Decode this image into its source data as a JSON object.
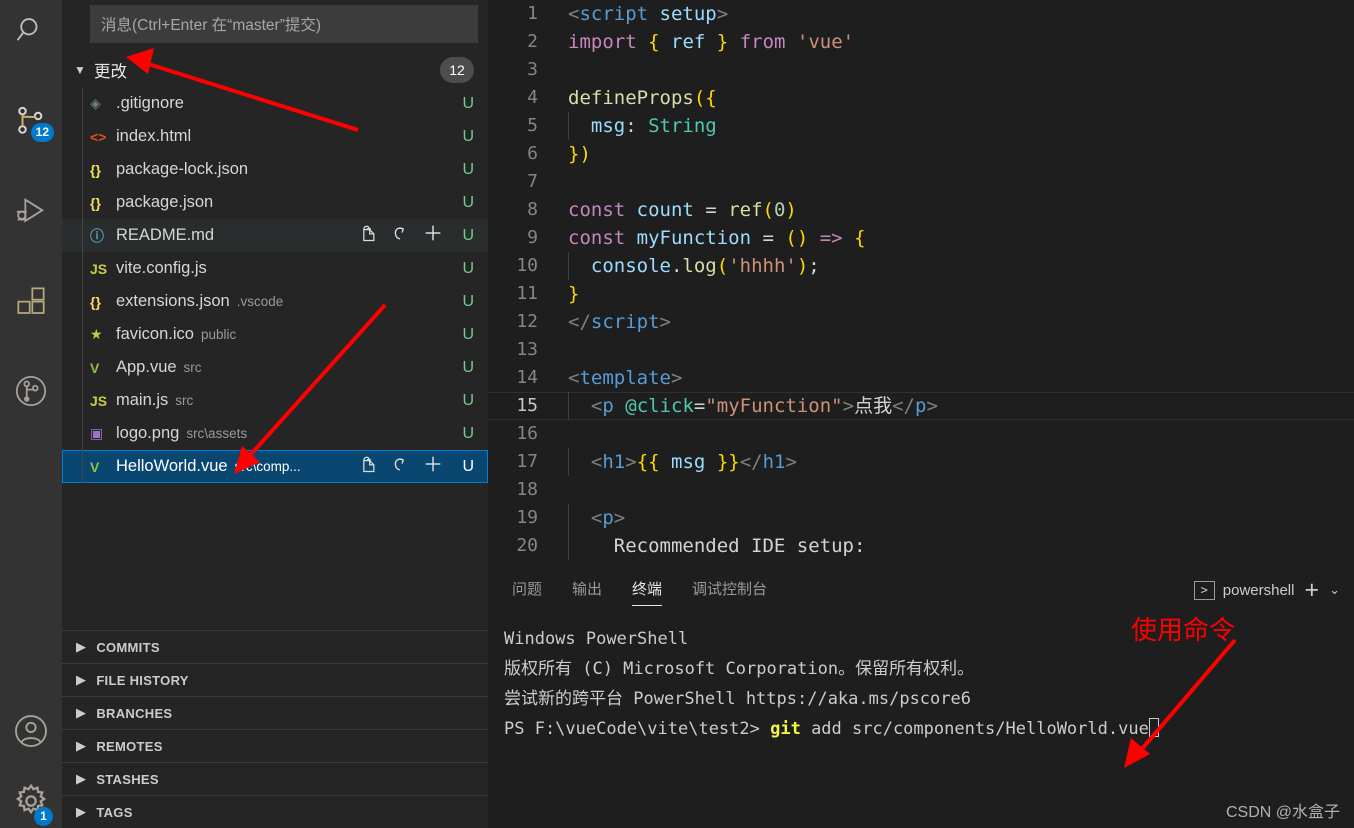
{
  "activitybar": {
    "items": [
      {
        "name": "search-icon",
        "badge": null
      },
      {
        "name": "source-control-icon",
        "badge": "12"
      },
      {
        "name": "run-debug-icon",
        "badge": null
      },
      {
        "name": "extensions-icon",
        "badge": null
      },
      {
        "name": "git-graph-icon",
        "badge": null
      }
    ],
    "bottom": [
      {
        "name": "accounts-icon",
        "badge": null
      },
      {
        "name": "settings-gear-icon",
        "badge": "1"
      }
    ]
  },
  "sidebar": {
    "commit_input_placeholder": "消息(Ctrl+Enter 在“master”提交)",
    "changes_label": "更改",
    "changes_count": "12",
    "row_actions": {
      "open_file": "open-file-icon",
      "discard": "discard-changes-icon",
      "stage": "stage-changes-icon"
    },
    "files": [
      {
        "icon": "git-file-icon",
        "icon_glyph": "◈",
        "icon_color": "#6d8086",
        "name": ".gitignore",
        "path": "",
        "status": "U",
        "state": "normal"
      },
      {
        "icon": "html-file-icon",
        "icon_glyph": "<>",
        "icon_color": "#e44d26",
        "name": "index.html",
        "path": "",
        "status": "U",
        "state": "normal"
      },
      {
        "icon": "json-file-icon",
        "icon_glyph": "{}",
        "icon_color": "#f1e05a",
        "name": "package-lock.json",
        "path": "",
        "status": "U",
        "state": "normal"
      },
      {
        "icon": "json-file-icon",
        "icon_glyph": "{}",
        "icon_color": "#f1e05a",
        "name": "package.json",
        "path": "",
        "status": "U",
        "state": "normal"
      },
      {
        "icon": "markdown-file-icon",
        "icon_glyph": "ⓘ",
        "icon_color": "#519aba",
        "name": "README.md",
        "path": "",
        "status": "U",
        "state": "hovered"
      },
      {
        "icon": "js-file-icon",
        "icon_glyph": "JS",
        "icon_color": "#cbcb41",
        "name": "vite.config.js",
        "path": "",
        "status": "U",
        "state": "normal"
      },
      {
        "icon": "json-file-icon",
        "icon_glyph": "{}",
        "icon_color": "#f1e05a",
        "name": "extensions.json",
        "path": ".vscode",
        "status": "U",
        "state": "normal"
      },
      {
        "icon": "favicon-file-icon",
        "icon_glyph": "★",
        "icon_color": "#cbcb41",
        "name": "favicon.ico",
        "path": "public",
        "status": "U",
        "state": "normal"
      },
      {
        "icon": "vue-file-icon",
        "icon_glyph": "V",
        "icon_color": "#8dc149",
        "name": "App.vue",
        "path": "src",
        "status": "U",
        "state": "normal"
      },
      {
        "icon": "js-file-icon",
        "icon_glyph": "JS",
        "icon_color": "#cbcb41",
        "name": "main.js",
        "path": "src",
        "status": "U",
        "state": "normal"
      },
      {
        "icon": "image-file-icon",
        "icon_glyph": "▣",
        "icon_color": "#a074c4",
        "name": "logo.png",
        "path": "src\\assets",
        "status": "U",
        "state": "normal"
      },
      {
        "icon": "vue-file-icon",
        "icon_glyph": "V",
        "icon_color": "#8dc149",
        "name": "HelloWorld.vue",
        "path": "src\\comp...",
        "status": "U",
        "state": "selected"
      }
    ],
    "sections": [
      {
        "label": "COMMITS"
      },
      {
        "label": "FILE HISTORY"
      },
      {
        "label": "BRANCHES"
      },
      {
        "label": "REMOTES"
      },
      {
        "label": "STASHES"
      },
      {
        "label": "TAGS"
      }
    ]
  },
  "editor": {
    "active_line": 15,
    "lines": [
      {
        "n": "1",
        "indent": false,
        "tokens": [
          {
            "c": "t-punc",
            "t": "<"
          },
          {
            "c": "t-tag",
            "t": "script"
          },
          {
            "c": "t-white",
            "t": " "
          },
          {
            "c": "t-attr",
            "t": "setup"
          },
          {
            "c": "t-punc",
            "t": ">"
          }
        ]
      },
      {
        "n": "2",
        "indent": false,
        "tokens": [
          {
            "c": "t-kw",
            "t": "import"
          },
          {
            "c": "t-white",
            "t": " "
          },
          {
            "c": "t-brace",
            "t": "{"
          },
          {
            "c": "t-white",
            "t": " "
          },
          {
            "c": "t-var",
            "t": "ref"
          },
          {
            "c": "t-white",
            "t": " "
          },
          {
            "c": "t-brace",
            "t": "}"
          },
          {
            "c": "t-white",
            "t": " "
          },
          {
            "c": "t-kw",
            "t": "from"
          },
          {
            "c": "t-white",
            "t": " "
          },
          {
            "c": "t-str",
            "t": "'vue'"
          }
        ]
      },
      {
        "n": "3",
        "indent": false,
        "tokens": []
      },
      {
        "n": "4",
        "indent": false,
        "tokens": [
          {
            "c": "t-fn",
            "t": "defineProps"
          },
          {
            "c": "t-brace",
            "t": "("
          },
          {
            "c": "t-brace",
            "t": "{"
          }
        ]
      },
      {
        "n": "5",
        "indent": true,
        "tokens": [
          {
            "c": "t-white",
            "t": "  "
          },
          {
            "c": "t-var",
            "t": "msg"
          },
          {
            "c": "t-white",
            "t": ": "
          },
          {
            "c": "t-type",
            "t": "String"
          }
        ]
      },
      {
        "n": "6",
        "indent": false,
        "tokens": [
          {
            "c": "t-brace",
            "t": "}"
          },
          {
            "c": "t-brace",
            "t": ")"
          }
        ]
      },
      {
        "n": "7",
        "indent": false,
        "tokens": []
      },
      {
        "n": "8",
        "indent": false,
        "tokens": [
          {
            "c": "t-kw",
            "t": "const"
          },
          {
            "c": "t-white",
            "t": " "
          },
          {
            "c": "t-var",
            "t": "count"
          },
          {
            "c": "t-white",
            "t": " = "
          },
          {
            "c": "t-fn",
            "t": "ref"
          },
          {
            "c": "t-brace",
            "t": "("
          },
          {
            "c": "t-num",
            "t": "0"
          },
          {
            "c": "t-brace",
            "t": ")"
          }
        ]
      },
      {
        "n": "9",
        "indent": false,
        "tokens": [
          {
            "c": "t-kw",
            "t": "const"
          },
          {
            "c": "t-white",
            "t": " "
          },
          {
            "c": "t-var",
            "t": "myFunction"
          },
          {
            "c": "t-white",
            "t": " = "
          },
          {
            "c": "t-brace",
            "t": "()"
          },
          {
            "c": "t-white",
            "t": " "
          },
          {
            "c": "t-kw",
            "t": "=>"
          },
          {
            "c": "t-white",
            "t": " "
          },
          {
            "c": "t-brace",
            "t": "{"
          }
        ]
      },
      {
        "n": "10",
        "indent": true,
        "tokens": [
          {
            "c": "t-white",
            "t": "  "
          },
          {
            "c": "t-var",
            "t": "console"
          },
          {
            "c": "t-white",
            "t": "."
          },
          {
            "c": "t-fn",
            "t": "log"
          },
          {
            "c": "t-brace",
            "t": "("
          },
          {
            "c": "t-str",
            "t": "'hhhh'"
          },
          {
            "c": "t-brace",
            "t": ")"
          },
          {
            "c": "t-white",
            "t": ";"
          }
        ]
      },
      {
        "n": "11",
        "indent": false,
        "tokens": [
          {
            "c": "t-brace",
            "t": "}"
          }
        ]
      },
      {
        "n": "12",
        "indent": false,
        "tokens": [
          {
            "c": "t-punc",
            "t": "</"
          },
          {
            "c": "t-tag",
            "t": "script"
          },
          {
            "c": "t-punc",
            "t": ">"
          }
        ]
      },
      {
        "n": "13",
        "indent": false,
        "tokens": []
      },
      {
        "n": "14",
        "indent": false,
        "tokens": [
          {
            "c": "t-punc",
            "t": "<"
          },
          {
            "c": "t-tag",
            "t": "template"
          },
          {
            "c": "t-punc",
            "t": ">"
          }
        ]
      },
      {
        "n": "15",
        "indent": true,
        "tokens": [
          {
            "c": "t-white",
            "t": "  "
          },
          {
            "c": "t-punc",
            "t": "<"
          },
          {
            "c": "t-tag",
            "t": "p"
          },
          {
            "c": "t-white",
            "t": " "
          },
          {
            "c": "t-tagname",
            "t": "@click"
          },
          {
            "c": "t-white",
            "t": "="
          },
          {
            "c": "t-str",
            "t": "\"myFunction\""
          },
          {
            "c": "t-punc",
            "t": ">"
          },
          {
            "c": "t-cn",
            "t": "点我"
          },
          {
            "c": "t-punc",
            "t": "</"
          },
          {
            "c": "t-tag",
            "t": "p"
          },
          {
            "c": "t-punc",
            "t": ">"
          }
        ]
      },
      {
        "n": "16",
        "indent": true,
        "tokens": []
      },
      {
        "n": "17",
        "indent": true,
        "tokens": [
          {
            "c": "t-white",
            "t": "  "
          },
          {
            "c": "t-punc",
            "t": "<"
          },
          {
            "c": "t-tag",
            "t": "h1"
          },
          {
            "c": "t-punc",
            "t": ">"
          },
          {
            "c": "t-brace",
            "t": "{{"
          },
          {
            "c": "t-white",
            "t": " "
          },
          {
            "c": "t-var",
            "t": "msg"
          },
          {
            "c": "t-white",
            "t": " "
          },
          {
            "c": "t-brace",
            "t": "}}"
          },
          {
            "c": "t-punc",
            "t": "</"
          },
          {
            "c": "t-tag",
            "t": "h1"
          },
          {
            "c": "t-punc",
            "t": ">"
          }
        ]
      },
      {
        "n": "18",
        "indent": true,
        "tokens": []
      },
      {
        "n": "19",
        "indent": true,
        "tokens": [
          {
            "c": "t-white",
            "t": "  "
          },
          {
            "c": "t-punc",
            "t": "<"
          },
          {
            "c": "t-tag",
            "t": "p"
          },
          {
            "c": "t-punc",
            "t": ">"
          }
        ]
      },
      {
        "n": "20",
        "indent": true,
        "tokens": [
          {
            "c": "t-white",
            "t": "    "
          },
          {
            "c": "t-white",
            "t": "Recommended IDE setup:"
          }
        ]
      }
    ]
  },
  "panel": {
    "tabs": [
      {
        "label": "问题",
        "active": false
      },
      {
        "label": "输出",
        "active": false
      },
      {
        "label": "终端",
        "active": true
      },
      {
        "label": "调试控制台",
        "active": false
      }
    ],
    "terminal_name": "powershell",
    "new_terminal_label": "+",
    "chevron_label": "⌄",
    "terminal_lines": [
      [
        {
          "c": "",
          "t": "Windows PowerShell"
        }
      ],
      [
        {
          "c": "",
          "t": "版权所有 (C) Microsoft Corporation。保留所有权利。"
        }
      ],
      [
        {
          "c": "",
          "t": ""
        }
      ],
      [
        {
          "c": "",
          "t": "尝试新的跨平台 PowerShell https://aka.ms/pscore6"
        }
      ],
      [
        {
          "c": "",
          "t": ""
        }
      ],
      [
        {
          "c": "",
          "t": "PS F:\\vueCode\\vite\\test2> "
        },
        {
          "c": "t-git",
          "t": "git"
        },
        {
          "c": "",
          "t": " add src/components/HelloWorld.vue"
        }
      ]
    ],
    "watermark": "CSDN @水盒子"
  },
  "annotations": {
    "accent_color": "#ff0000",
    "label_command": "使用命令"
  }
}
